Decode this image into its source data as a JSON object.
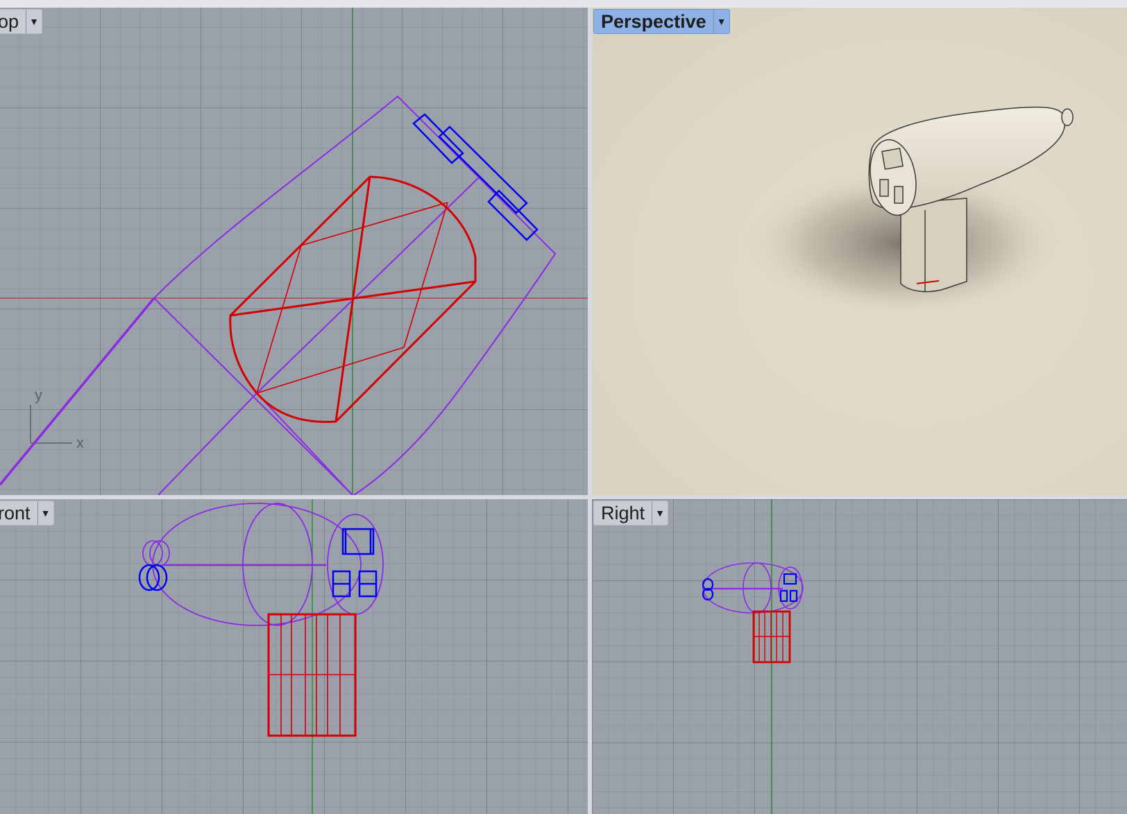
{
  "viewports": {
    "top": {
      "label": "op",
      "axis_y": "y",
      "axis_x": "x"
    },
    "perspective": {
      "label": "Perspective"
    },
    "front": {
      "label": "ront"
    },
    "right": {
      "label": "Right"
    }
  },
  "icons": {
    "dropdown": "chevron-down-icon"
  },
  "colors": {
    "grid_bg": "#9aa1aa",
    "perspective_bg": "#ddd7c6",
    "active_label": "#8fb2e6",
    "wire_purple": "#8a2be2",
    "wire_red": "#d40000",
    "wire_blue": "#0000ee",
    "axis_green": "#2f8a2f",
    "axis_red": "#b53a3a"
  }
}
